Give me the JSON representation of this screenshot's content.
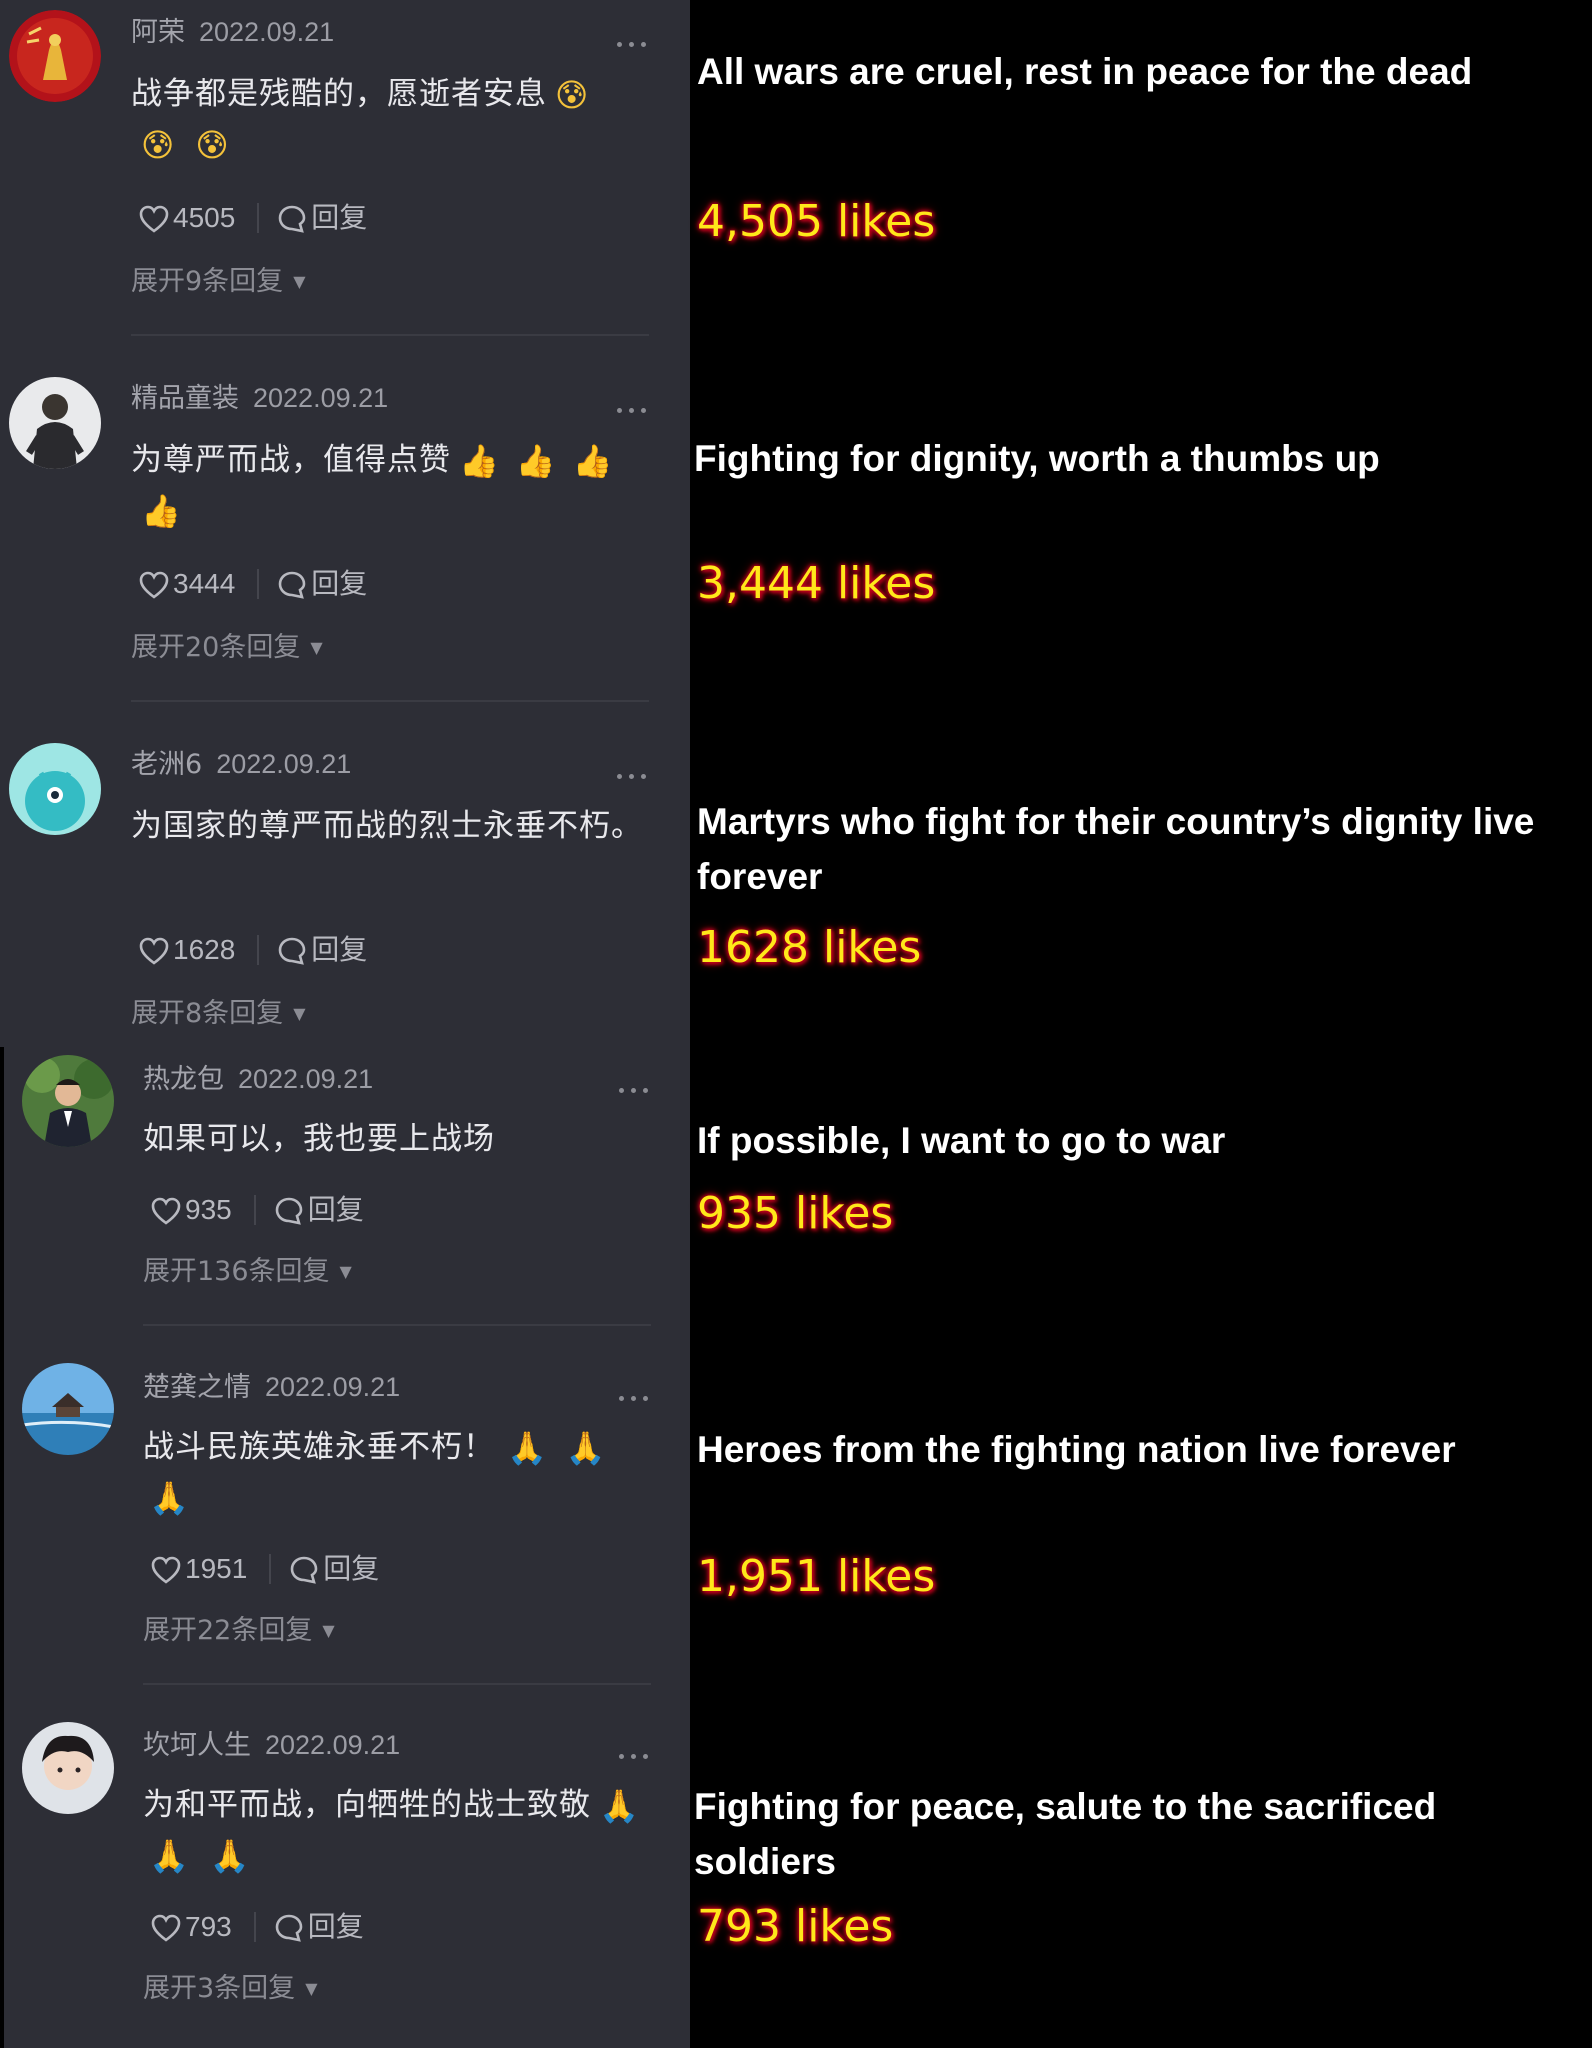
{
  "colors": {
    "panel_background": "#2d2e36",
    "page_background": "#000000",
    "username": "#a3a4ac",
    "comment_text": "#e8e8ec",
    "translation_text": "#ffffff",
    "likes_text": "#ffe81a",
    "likes_glow": "#c8001e"
  },
  "comments": [
    {
      "username": "阿荣",
      "date": "2022.09.21",
      "text": "战争都是残酷的，愿逝者安息",
      "emoji": "cry-emoji",
      "emoji_glyphs": [
        "😰",
        "😰",
        "😰"
      ],
      "likes": "4505",
      "reply_label": "回复",
      "expand_label": "展开9条回复",
      "avatar": "red-new-year-avatar",
      "translation": "All wars are cruel, rest in peace for the dead",
      "translated_likes": "4,505 likes"
    },
    {
      "username": "精品童装",
      "date": "2022.09.21",
      "text": "为尊严而战，值得点赞",
      "emoji": "thumbs-up-emoji",
      "emoji_glyphs": [
        "👍",
        "👍",
        "👍",
        "👍"
      ],
      "likes": "3444",
      "reply_label": "回复",
      "expand_label": "展开20条回复",
      "avatar": "child-photo-avatar",
      "translation": "Fighting for dignity, worth a thumbs up",
      "translated_likes": "3,444 likes"
    },
    {
      "username": "老洲6",
      "date": "2022.09.21",
      "text": "为国家的尊严而战的烈士永垂不朽。",
      "emoji": "",
      "emoji_glyphs": [],
      "likes": "1628",
      "reply_label": "回复",
      "expand_label": "展开8条回复",
      "avatar": "teal-cartoon-avatar",
      "translation": "Martyrs who fight for their country’s dignity live forever",
      "translated_likes": "1628 likes"
    },
    {
      "username": "热龙包",
      "date": "2022.09.21",
      "text": "如果可以，我也要上战场",
      "emoji": "",
      "emoji_glyphs": [],
      "likes": "935",
      "reply_label": "回复",
      "expand_label": "展开136条回复",
      "avatar": "man-outdoor-avatar",
      "translation": "If possible, I want to go to war",
      "translated_likes": "935 likes"
    },
    {
      "username": "楚龚之情",
      "date": "2022.09.21",
      "text": "战斗民族英雄永垂不朽！",
      "emoji": "praying-hands-emoji",
      "emoji_glyphs": [
        "🙏",
        "🙏",
        "🙏"
      ],
      "likes": "1951",
      "reply_label": "回复",
      "expand_label": "展开22条回复",
      "avatar": "seaside-pavilion-avatar",
      "translation": "Heroes from the fighting nation live forever",
      "translated_likes": "1,951 likes"
    },
    {
      "username": "坎坷人生",
      "date": "2022.09.21",
      "text": "为和平而战，向牺牲的战士致敬",
      "emoji": "praying-hands-emoji",
      "emoji_glyphs": [
        "🙏",
        "🙏",
        "🙏"
      ],
      "likes": "793",
      "reply_label": "回复",
      "expand_label": "展开3条回复",
      "avatar": "young-man-avatar",
      "translation": "Fighting for peace, salute to the sacrificed soldiers",
      "translated_likes": "793 likes"
    }
  ]
}
